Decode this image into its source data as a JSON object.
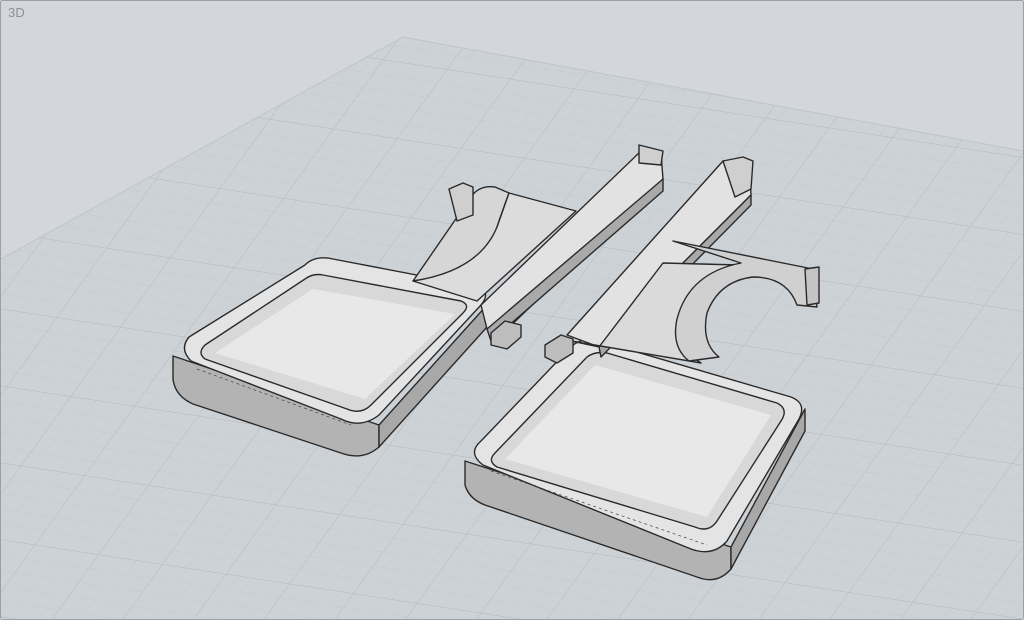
{
  "viewport": {
    "label": "3D",
    "background": "#d3d7dc"
  },
  "scene": {
    "grid_color": "#b7bcc2",
    "plane_color": "#c9ced4",
    "part_top_color": "#e3e3e3",
    "part_side_color": "#b3b3b3",
    "edge_color": "#2a2a2a",
    "objects": [
      {
        "name": "left-tray-part"
      },
      {
        "name": "right-tray-part"
      }
    ]
  }
}
